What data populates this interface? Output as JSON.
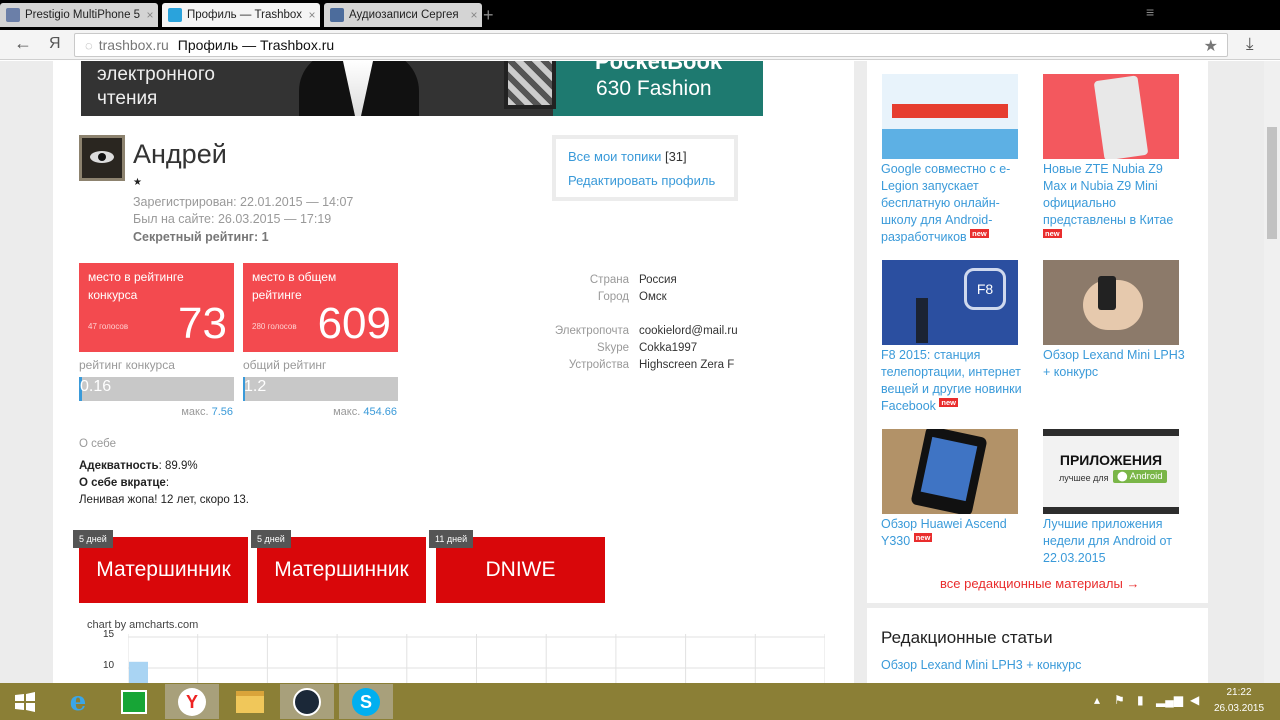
{
  "browser": {
    "tabs": [
      {
        "title": "Prestigio MultiPhone 5",
        "active": false
      },
      {
        "title": "Профиль — Trashbox",
        "active": true
      },
      {
        "title": "Аудиозаписи Сергея",
        "active": false
      }
    ],
    "url_domain": "trashbox.ru",
    "url_title": "Профиль — Trashbox.ru"
  },
  "banner": {
    "line1": "электронного",
    "line2": "чтения",
    "brand": "PocketBook",
    "model": "630 Fashion"
  },
  "profile": {
    "name": "Андрей",
    "star": "★",
    "registered": "Зарегистрирован: 22.01.2015 — 14:07",
    "last_seen": "Был на сайте: 26.03.2015 — 17:19",
    "secret_rating": "Секретный рейтинг: 1"
  },
  "links": {
    "topics": "Все мои топики",
    "topics_count": "[31]",
    "edit": "Редактировать профиль"
  },
  "ratings": [
    {
      "label": "место в рейтинге конкурса",
      "votes": "47 голосов",
      "place": "73",
      "bar_label": "рейтинг конкурса",
      "value": "0.16",
      "max_label": "макс.",
      "max": "7.56",
      "fill": 0.021
    },
    {
      "label": "место в общем рейтинге",
      "votes": "280 голосов",
      "place": "609",
      "bar_label": "общий рейтинг",
      "value": "1.2",
      "max_label": "макс.",
      "max": "454.66",
      "fill": 0.003
    }
  ],
  "fields": [
    {
      "label": "Страна",
      "value": "Россия"
    },
    {
      "label": "Город",
      "value": "Омск"
    },
    {
      "label": "Электропочта",
      "value": "cookielord@mail.ru"
    },
    {
      "label": "Skype",
      "value": "Cokka1997"
    },
    {
      "label": "Устройства",
      "value": "Highscreen Zera F"
    }
  ],
  "about": {
    "heading": "О себе",
    "adequacy_label": "Адекватность",
    "adequacy_value": ": 89.9%",
    "brief_label": "О себе вкратце",
    "brief_colon": ":",
    "brief_text": "Ленивая жопа! 12 лет, скоро 13."
  },
  "awards": [
    {
      "days": "5 дней",
      "title": "Матершинник"
    },
    {
      "days": "5 дней",
      "title": "Матершинник"
    },
    {
      "days": "11 дней",
      "title": "DNIWE"
    }
  ],
  "chart": {
    "credit": "chart by amcharts.com",
    "y_ticks": [
      "15",
      "10"
    ],
    "bar_value": 11
  },
  "sidebar": {
    "cards": [
      {
        "title": "Google совместно с e-Legion запускает бесплатную онлайн-школу для Android-разработчиков",
        "new": true,
        "img_color": "#4aa3df"
      },
      {
        "title": "Новые ZTE Nubia Z9 Max и Nubia Z9 Mini официально представлены в Китае",
        "new": true,
        "img_color": "#f3585e"
      },
      {
        "title": "F8 2015: станция телепортации, интернет вещей и другие новинки Facebook",
        "new": true,
        "img_color": "#2b4fa0"
      },
      {
        "title": "Обзор Lexand Mini LPH3 + конкурс",
        "new": false,
        "img_color": "#7a6a5a"
      },
      {
        "title": "Обзор Huawei Ascend Y330",
        "new": true,
        "img_color": "#a0845e"
      },
      {
        "title": "Лучшие приложения недели для Android от 22.03.2015",
        "new": false,
        "img_color": "#2d2d2d"
      }
    ],
    "new_badge": "new",
    "apps_img_title": "ПРИЛОЖЕНИЯ",
    "apps_img_sub": "лучшее для",
    "apps_img_android": "Android",
    "all_materials": "все редакционные материалы →",
    "editorial_heading": "Редакционные статьи",
    "editorial_first": "Обзор Lexand Mini LPH3 + конкурс"
  },
  "taskbar": {
    "time": "21:22",
    "date": "26.03.2015"
  }
}
